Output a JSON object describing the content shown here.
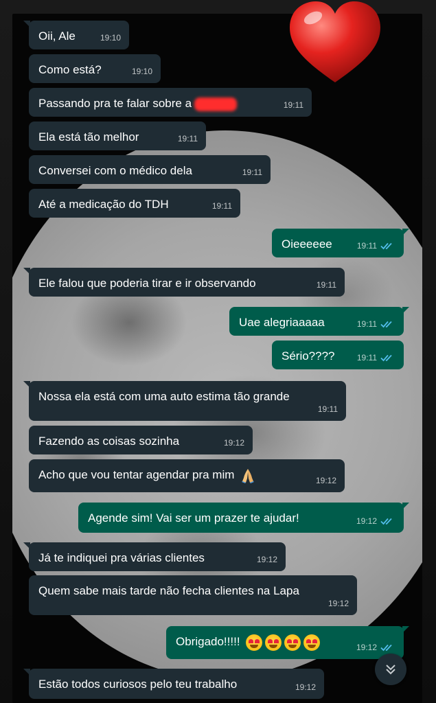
{
  "messages": [
    {
      "text": "Oii, Ale",
      "time": "19:10"
    },
    {
      "text": "Como está?",
      "time": "19:10"
    },
    {
      "text": "Passando pra te falar sobre a",
      "time": "19:11"
    },
    {
      "text": "Ela está tão melhor",
      "time": "19:11"
    },
    {
      "text": "Conversei com o médico dela",
      "time": "19:11"
    },
    {
      "text": "Até a medicação do TDH",
      "time": "19:11"
    },
    {
      "text": "Oieeeeee",
      "time": "19:11"
    },
    {
      "text": "Ele falou que poderia tirar e ir observando",
      "time": "19:11"
    },
    {
      "text": "Uae alegriaaaaa",
      "time": "19:11"
    },
    {
      "text": "Sério????",
      "time": "19:11"
    },
    {
      "text": "Nossa ela está com uma auto estima tão grande",
      "time": "19:11"
    },
    {
      "text": "Fazendo as coisas sozinha",
      "time": "19:12"
    },
    {
      "text": "Acho que vou tentar agendar pra mim",
      "time": "19:12"
    },
    {
      "text": "Agende sim! Vai ser um prazer te ajudar!",
      "time": "19:12"
    },
    {
      "text": "Já te indiquei pra várias clientes",
      "time": "19:12"
    },
    {
      "text": "Quem sabe mais tarde não fecha clientes na Lapa",
      "time": "19:12"
    },
    {
      "text": "Obrigado!!!!!",
      "time": "19:12"
    },
    {
      "text": "Estão todos curiosos pelo teu trabalho",
      "time": "19:12"
    }
  ],
  "icons": {
    "read_receipt": "double-check-icon",
    "scroll_down": "chevron-double-down-icon",
    "sticker": "heart-sticker",
    "pray": "praying-hands-emoji",
    "heart_eyes": "heart-eyes-emoji"
  },
  "colors": {
    "incoming_bubble": "#1f2c34",
    "outgoing_bubble": "#005c4b",
    "read_tick": "#53bdeb",
    "redaction": "#ff2d2d"
  }
}
